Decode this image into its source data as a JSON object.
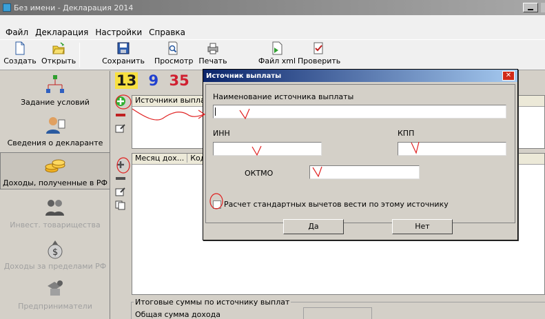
{
  "window": {
    "title": "Без имени - Декларация 2014"
  },
  "menu": {
    "items": [
      "Файл",
      "Декларация",
      "Настройки",
      "Справка"
    ]
  },
  "toolbar": {
    "buttons": [
      {
        "label": "Создать",
        "icon": "new-doc-icon"
      },
      {
        "label": "Открыть",
        "icon": "open-folder-icon"
      },
      {
        "label": "Сохранить",
        "icon": "save-icon"
      },
      {
        "label": "Просмотр",
        "icon": "preview-icon"
      },
      {
        "label": "Печать",
        "icon": "print-icon"
      },
      {
        "label": "Файл xml",
        "icon": "xml-file-icon"
      },
      {
        "label": "Проверить",
        "icon": "check-icon"
      }
    ]
  },
  "sidebar": {
    "items": [
      {
        "label": "Задание условий",
        "icon": "conditions-icon",
        "enabled": true
      },
      {
        "label": "Сведения о декларанте",
        "icon": "declarant-icon",
        "enabled": true
      },
      {
        "label": "Доходы, полученные в РФ",
        "icon": "income-rf-icon",
        "enabled": true,
        "selected": true
      },
      {
        "label": "Инвест. товарищества",
        "icon": "investment-icon",
        "enabled": false
      },
      {
        "label": "Доходы за пределами РФ",
        "icon": "foreign-income-icon",
        "enabled": false
      },
      {
        "label": "Предприниматели",
        "icon": "entrepreneurs-icon",
        "enabled": false
      }
    ]
  },
  "rates": {
    "r1": "13",
    "r2": "9",
    "r3": "35"
  },
  "sources_list": {
    "header": "Источники выплат"
  },
  "income_list": {
    "col1": "Месяц дох...",
    "col2": "Код д"
  },
  "summary": {
    "legend": "Итоговые суммы по источнику выплат",
    "total_label": "Общая сумма дохода"
  },
  "dialog": {
    "title": "Источник выплаты",
    "close": "✕",
    "name_label": "Наименование источника выплаты",
    "name_value": "",
    "inn_label": "ИНН",
    "inn_value": "",
    "kpp_label": "КПП",
    "kpp_value": "",
    "oktmo_label": "ОКТМО",
    "oktmo_value": "",
    "checkbox_label": "Расчет стандартных вычетов вести по этому источнику",
    "checkbox_checked": false,
    "ok": "Да",
    "cancel": "Нет"
  },
  "colors": {
    "annotation": "#e02020",
    "rate1": "#1a1a1a",
    "rate2": "#2040d0",
    "rate3": "#d02030"
  }
}
